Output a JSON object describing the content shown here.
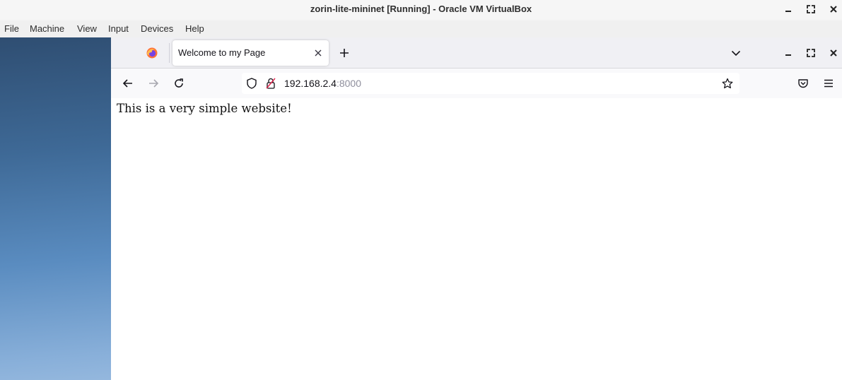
{
  "host": {
    "title": "zorin-lite-mininet [Running] - Oracle VM VirtualBox",
    "menu": [
      "File",
      "Machine",
      "View",
      "Input",
      "Devices",
      "Help"
    ],
    "controls": {
      "minimize_icon": "minimize-icon",
      "maximize_icon": "maximize-icon",
      "close_icon": "close-icon"
    }
  },
  "browser": {
    "tab": {
      "title": "Welcome to my Page"
    },
    "url": {
      "host": "192.168.2.4",
      "port": ":8000"
    }
  },
  "page": {
    "text": "This is a very simple website!"
  },
  "colors": {
    "desktop_top": "#2f4e72",
    "desktop_bottom": "#b0cbe8",
    "tabbar": "#f0f0f4",
    "navbar": "#f9f9fb"
  }
}
